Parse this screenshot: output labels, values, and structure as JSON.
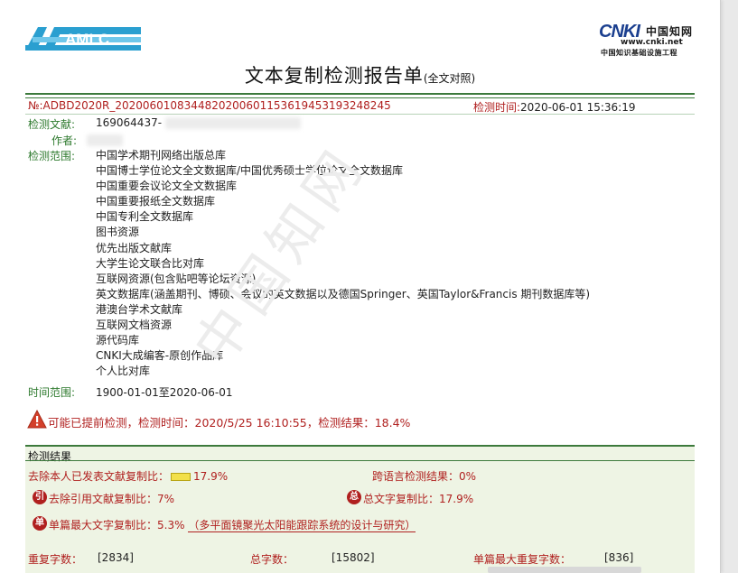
{
  "header": {
    "left_logo_text": "AMLC",
    "cnki_mark": "CNKI",
    "cnki_cn": "中国知网",
    "cnki_url": "www.cnki.net",
    "cnki_sub": "中国知识基础设施工程"
  },
  "title": {
    "main": "文本复制检测报告单",
    "suffix": "(全文对照)"
  },
  "meta": {
    "report_no": "№:ADBD2020R_20200601083448202006011536194531932482​45",
    "check_time_label": "检测时间:",
    "check_time": "2020-06-01 15:36:19",
    "doc_label": "检测文献:",
    "doc_value": "169064437-",
    "author_label": "作者:",
    "range_label": "检测范围:",
    "ranges": [
      "中国学术期刊网络出版总库",
      "中国博士学位论文全文数据库/中国优秀硕士学位论文全文数据库",
      "中国重要会议论文全文数据库",
      "中国重要报纸全文数据库",
      "中国专利全文数据库",
      "图书资源",
      "优先出版文献库",
      "大学生论文联合比对库",
      "互联网资源(包含贴吧等论坛资源)",
      "英文数据库(涵盖期刊、博硕、会议的英文数据以及德国Springer、英国Taylor&Francis 期刊数据库等)",
      "港澳台学术文献库",
      "互联网文档资源",
      "源代码库",
      "CNKI大成编客-原创作品库",
      "个人比对库"
    ],
    "time_range_label": "时间范围:",
    "time_range": "1900-01-01至2020-06-01"
  },
  "warning": {
    "text": "可能已提前检测，检测时间：2020/5/25 16:10:55，检测结果：18.4%"
  },
  "results": {
    "section_title": "检测结果",
    "exclude_self_label": "去除本人已发表文献复制比：",
    "exclude_self_value": "17.9%",
    "cross_lang_label": "跨语言检测结果：",
    "cross_lang_value": "0%",
    "exclude_quote_icon": "引",
    "exclude_quote_label": "去除引用文献复制比：",
    "exclude_quote_value": "7%",
    "total_icon": "总",
    "total_label": "总文字复制比：",
    "total_value": "17.9%",
    "single_icon": "单",
    "single_label": "单篇最大文字复制比：",
    "single_value": "5.3%",
    "single_title": "（多平面镜聚光太阳能跟踪系统的设计与研究）",
    "repeat_chars_label": "重复字数：",
    "repeat_chars_value": "[2834]",
    "total_chars_label": "总字数：",
    "total_chars_value": "[15802]",
    "single_max_repeat_label": "单篇最大重复字数：",
    "single_max_repeat_value": "[836]"
  },
  "colors": {
    "accent_red": "#b0201f",
    "accent_green": "#3c7a3c",
    "result_bg": "#eef4e4"
  }
}
